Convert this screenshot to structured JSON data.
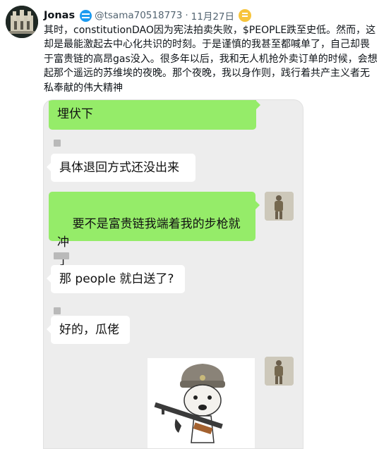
{
  "tweet": {
    "author_name": "Jonas",
    "handle": "@tsama70518773",
    "separator": "·",
    "date": "11月27日",
    "text": "其时，constitutionDAO因为宪法拍卖失败，$PEOPLE跌至史低。然而，这\n却是最能激起去中心化共识的时刻。于是谨慎的我甚至都喊单了，自己却畏\n于富贵链的高昂gas没入。很多年以后，我和无人机抢外卖订单的时候，会想\n起那个遥远的苏维埃的夜晚。那个夜晚，我以身作则，践行着共产主义者无\n私奉献的伟大精神"
  },
  "chat": {
    "messages": [
      {
        "side": "right",
        "text": "埋伏下"
      },
      {
        "side": "left",
        "text": "具体退回方式还没出来"
      },
      {
        "side": "right",
        "text": "要不是富贵链我端着我的步枪就冲\n了"
      },
      {
        "side": "left",
        "text": "那 people 就白送了?"
      },
      {
        "side": "left",
        "text": "好的，瓜佬"
      }
    ]
  },
  "icons": {
    "verified": "verified-badge-icon",
    "coin": "coin-badge-icon"
  },
  "colors": {
    "accent": "#1d9bf0",
    "bubble_green": "#95ec69",
    "chat_bg": "#ededed",
    "muted": "#536471"
  }
}
